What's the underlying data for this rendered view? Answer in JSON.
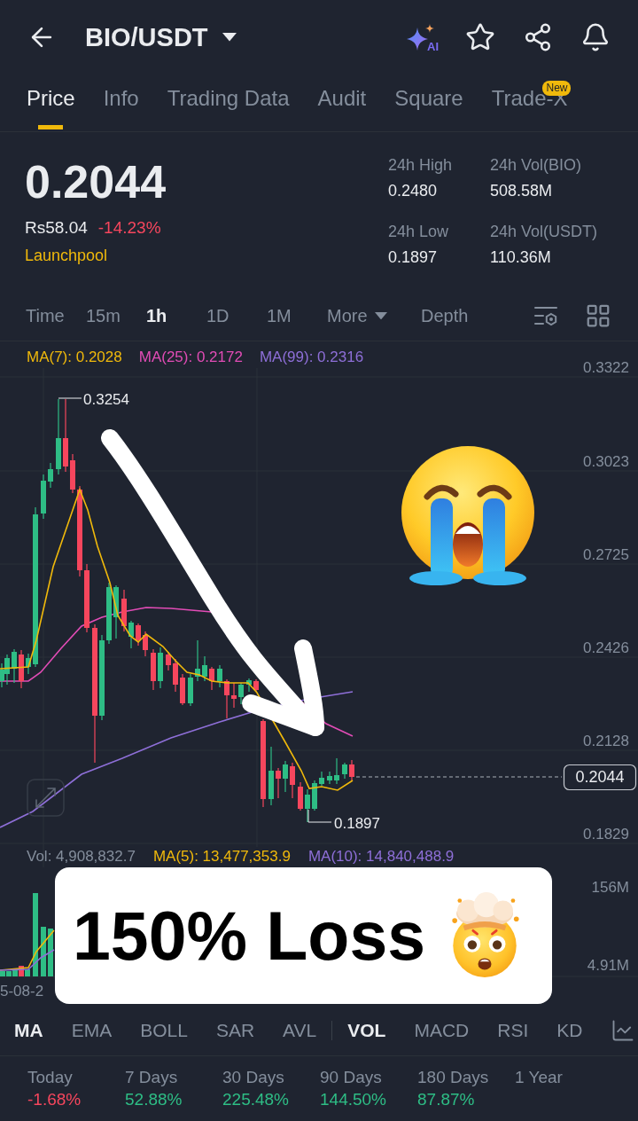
{
  "header": {
    "pair": "BIO/USDT",
    "ai_label": "AI"
  },
  "tabs": [
    {
      "label": "Price",
      "selected": true
    },
    {
      "label": "Info",
      "selected": false
    },
    {
      "label": "Trading Data",
      "selected": false
    },
    {
      "label": "Audit",
      "selected": false
    },
    {
      "label": "Square",
      "selected": false
    },
    {
      "label": "Trade-X",
      "selected": false,
      "badge": "New"
    }
  ],
  "ticker": {
    "price": "0.2044",
    "fiat_price": "Rs58.04",
    "change": "-14.23%",
    "negative": true,
    "tag": "Launchpool"
  },
  "stats": [
    {
      "label": "24h High",
      "value": "0.2480"
    },
    {
      "label": "24h Low",
      "value": "0.1897"
    },
    {
      "label": "24h Vol(BIO)",
      "value": "508.58M"
    },
    {
      "label": "24h Vol(USDT)",
      "value": "110.36M"
    }
  ],
  "intervals": [
    {
      "label": "Time",
      "kind": "option",
      "selected": false
    },
    {
      "label": "15m",
      "kind": "option",
      "selected": false
    },
    {
      "label": "1h",
      "kind": "option",
      "selected": true
    },
    {
      "label": "1D",
      "kind": "option",
      "selected": false
    },
    {
      "label": "1M",
      "kind": "option",
      "selected": false
    },
    {
      "label": "More",
      "kind": "dropdown",
      "selected": false
    },
    {
      "label": "Depth",
      "kind": "option",
      "selected": false
    }
  ],
  "chart": {
    "ma_legend": [
      {
        "label": "MA(7): 0.2028",
        "color": "#f0b90b"
      },
      {
        "label": "MA(25): 0.2172",
        "color": "#e24cb6"
      },
      {
        "label": "MA(99): 0.2316",
        "color": "#8e6fd8"
      }
    ],
    "price_axis": [
      "0.3322",
      "0.3023",
      "0.2725",
      "0.2426",
      "0.2128",
      "0.1829"
    ],
    "high_label": "0.3254",
    "low_label": "0.1897",
    "last_price": "0.2044"
  },
  "volume": {
    "legend": [
      {
        "label": "Vol: 4,908,832.7",
        "color": "#848e9c"
      },
      {
        "label": "MA(5): 13,477,353.9",
        "color": "#f0b90b"
      },
      {
        "label": "MA(10): 14,840,488.9",
        "color": "#8e6fd8"
      }
    ],
    "axis": [
      "156M",
      "4.91M"
    ],
    "date_label": "5-08-2"
  },
  "overlay": {
    "caption": "150% Loss"
  },
  "indicators": {
    "main": [
      {
        "label": "MA",
        "selected": true
      },
      {
        "label": "EMA",
        "selected": false
      },
      {
        "label": "BOLL",
        "selected": false
      },
      {
        "label": "SAR",
        "selected": false
      },
      {
        "label": "AVL",
        "selected": false
      }
    ],
    "sub": [
      {
        "label": "VOL",
        "selected": true
      },
      {
        "label": "MACD",
        "selected": false
      },
      {
        "label": "RSI",
        "selected": false
      },
      {
        "label": "KD",
        "selected": false
      }
    ]
  },
  "performance": [
    {
      "period": "Today",
      "change": "-1.68%",
      "negative": true
    },
    {
      "period": "7 Days",
      "change": "52.88%",
      "negative": false
    },
    {
      "period": "30 Days",
      "change": "225.48%",
      "negative": false
    },
    {
      "period": "90 Days",
      "change": "144.50%",
      "negative": false
    },
    {
      "period": "180 Days",
      "change": "87.87%",
      "negative": false
    },
    {
      "period": "1 Year"
    }
  ]
}
